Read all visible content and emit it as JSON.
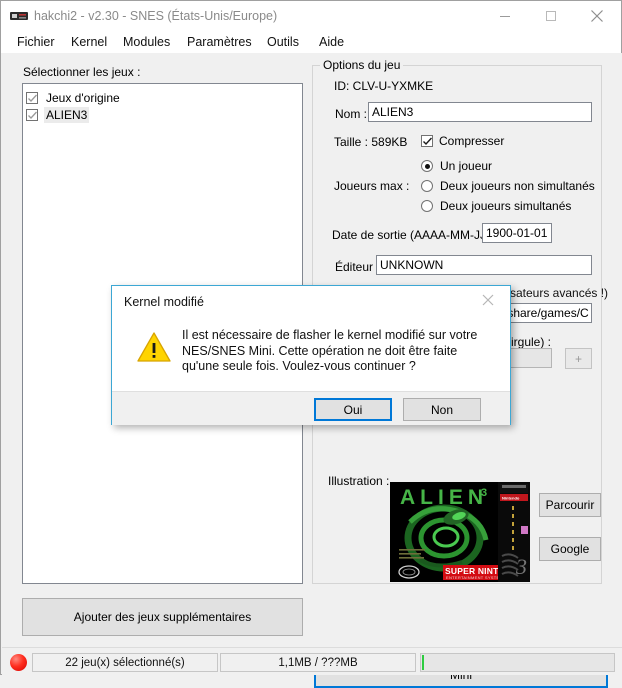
{
  "window": {
    "title": "hakchi2 - v2.30 - SNES (États-Unis/Europe)",
    "icon": "console-icon",
    "minimize": "minimize-icon",
    "maximize": "maximize-icon",
    "close": "close-icon"
  },
  "menu": [
    {
      "label": "Fichier"
    },
    {
      "label": "Kernel"
    },
    {
      "label": "Modules"
    },
    {
      "label": "Paramètres"
    },
    {
      "label": "Outils"
    },
    {
      "label": "Aide"
    }
  ],
  "left_panel": {
    "list_label": "Sélectionner les jeux :",
    "games": [
      {
        "label": "Jeux d'origine",
        "checked": true,
        "selected": false
      },
      {
        "label": "ALIEN3",
        "checked": true,
        "selected": true
      }
    ],
    "add_games_button": "Ajouter des jeux supplémentaires"
  },
  "game_options": {
    "legend": "Options du jeu",
    "id_label": "ID: CLV-U-YXMKE",
    "name_label": "Nom :",
    "name_value": "ALIEN3",
    "size_label": "Taille : 589KB",
    "compress_label": "Compresser",
    "compress_checked": true,
    "players_label": "Joueurs max :",
    "player_options": [
      {
        "label": "Un joueur",
        "selected": true
      },
      {
        "label": "Deux joueurs non simultanés",
        "selected": false
      },
      {
        "label": "Deux joueurs simultanés",
        "selected": false
      }
    ],
    "release_date_label": "Date de sortie (AAAA-MM-JJ) :",
    "release_date_value": "1900-01-01",
    "publisher_label": "Éditeur :",
    "publisher_value": "UNKNOWN",
    "advanced_note_partial": "ilisateurs avancés !)",
    "command_value_partial": "/share/games/C",
    "args_label_partial": "virgule) :",
    "add_arg_button": "+",
    "illustration_label": "Illustration :",
    "browse_button": "Parcourir",
    "google_button": "Google"
  },
  "sync_button": "Synchroniser les jeux sélectionnés avec la NES/SNES Mini",
  "status_bar": {
    "led": "red-led-icon",
    "selected_count": "22 jeu(x) sélectionné(s)",
    "size_info": "1,1MB / ???MB",
    "progress_percent": 1,
    "progress_color": "#2ecc40"
  },
  "dialog": {
    "title": "Kernel modifié",
    "close": "close-icon",
    "warning_icon": "warning-triangle-icon",
    "message": "Il est nécessaire de flasher le kernel modifié sur votre NES/SNES Mini. Cette opération ne doit être faite qu'une seule fois. Voulez-vous continuer ?",
    "yes_button": "Oui",
    "no_button": "Non",
    "border_color": "#3ca7d4",
    "focus_color": "#0078d7"
  },
  "boxart": {
    "title_text": "ALIEN",
    "superscript": "3",
    "banner_text": "SUPER NINTENDO",
    "banner_sub": "ENTERTAINMENT SYSTEM"
  }
}
